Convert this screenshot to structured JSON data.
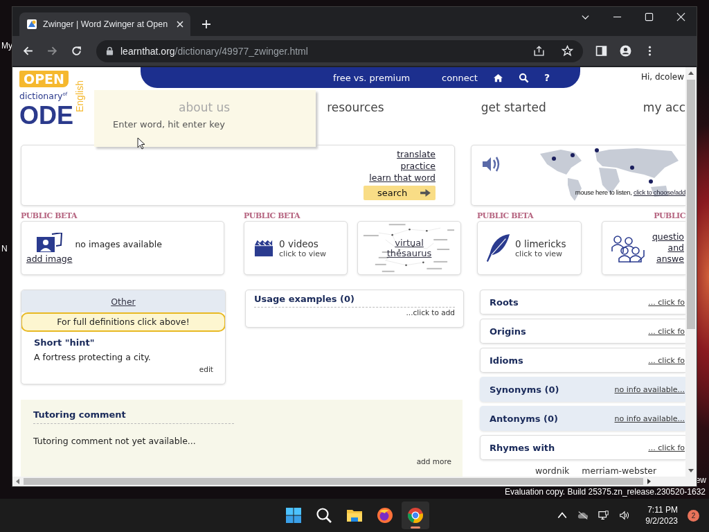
{
  "desktop": {
    "icon_labels": [
      "My",
      "N"
    ],
    "corner_label": "ew",
    "build_notice": "Evaluation copy. Build 25375.zn_release.230520-1632"
  },
  "browser": {
    "tab_title": "Zwinger | Word Zwinger at Open",
    "url_host": "learnthat.org",
    "url_path": "/dictionary/49977_zwinger.html"
  },
  "site": {
    "logo": {
      "open": "OPEN",
      "english": "English",
      "dictionary": "dictionary",
      "of": "of",
      "ode": "ODE"
    },
    "top_links": [
      "free vs. premium",
      "connect"
    ],
    "help_glyph": "?",
    "greeting": "Hi, dcolew",
    "main_nav": [
      "about us",
      "resources",
      "get started",
      "my acc"
    ],
    "search_popup": {
      "placeholder": "Enter word, hit enter key"
    },
    "search_links": [
      "translate",
      "practice",
      "learn that word"
    ],
    "search_button": "search",
    "audio": {
      "hint": "mouse here to listen,",
      "link": "click to choose/add"
    },
    "cards": [
      {
        "kind": "images",
        "beta": "PUBLIC BETA",
        "text": "no images available",
        "link": "add image"
      },
      {
        "kind": "videos",
        "beta": "PUBLIC BETA",
        "title": "0 videos",
        "sub": "click to view"
      },
      {
        "kind": "thesaurus",
        "link": "virtual thesaurus"
      },
      {
        "kind": "limericks",
        "beta": "PUBLIC BETA",
        "title": "0 limericks",
        "sub": "click to view"
      },
      {
        "kind": "qa",
        "beta": "PUBLIC",
        "link": "questio and answe"
      }
    ],
    "other": {
      "tab": "Other",
      "notice": "For full definitions click above!",
      "hint_title": "Short \"hint\"",
      "hint_text": "A fortress protecting a city.",
      "edit": "edit"
    },
    "usage": {
      "title": "Usage examples (0)",
      "add": "...click to add"
    },
    "tutoring": {
      "title": "Tutoring comment",
      "text": "Tutoring comment not yet available...",
      "add": "add more"
    },
    "sections": [
      {
        "title": "Roots",
        "link": "... click fo",
        "highlighted": false
      },
      {
        "title": "Origins",
        "link": "... click fo",
        "highlighted": false
      },
      {
        "title": "Idioms",
        "link": "... click fo",
        "highlighted": false
      },
      {
        "title": "Synonyms (0)",
        "link": "no info available...",
        "highlighted": true
      },
      {
        "title": "Antonyms (0)",
        "link": "no info available...",
        "highlighted": true
      },
      {
        "title": "Rhymes with",
        "link": "... click fo",
        "highlighted": false
      }
    ],
    "bottom_links": [
      "wordnik",
      "merriam-webster"
    ]
  },
  "taskbar": {
    "apps": [
      {
        "kind": "start",
        "selected": false
      },
      {
        "kind": "search",
        "selected": false
      },
      {
        "kind": "files",
        "selected": false
      },
      {
        "kind": "firefox",
        "selected": false
      },
      {
        "kind": "chrome",
        "selected": true
      }
    ],
    "time": "7:11 PM",
    "date": "9/2/2023",
    "badge": "2"
  }
}
